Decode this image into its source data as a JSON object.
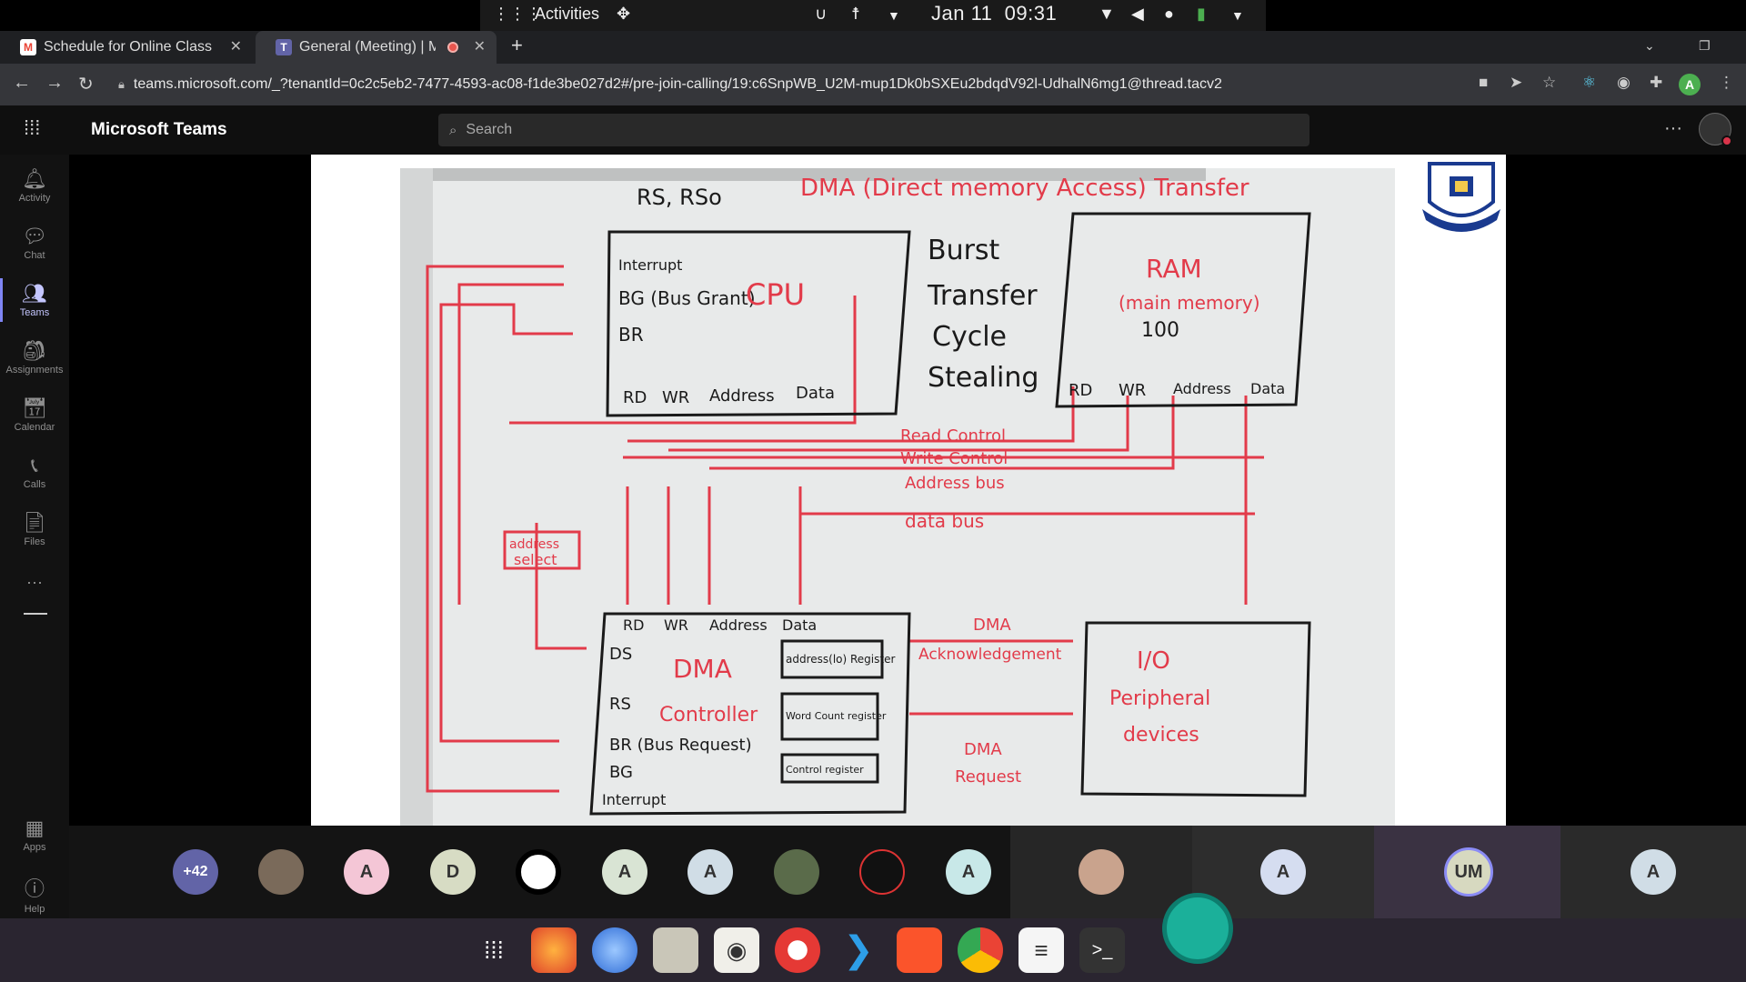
{
  "system_bar": {
    "apps_glyph": "⋮⋮⋮",
    "activities": "Activities",
    "date": "Jan 11",
    "time": "09:31"
  },
  "browser": {
    "tabs": [
      {
        "title": "Schedule for Online Class",
        "favicon": "gmail-icon",
        "active": false
      },
      {
        "title": "General (Meeting) | Mi",
        "favicon": "teams-icon",
        "active": true,
        "recording": true
      }
    ],
    "new_tab_label": "+",
    "url": "teams.microsoft.com/_?tenantId=0c2c5eb2-7477-4593-ac08-f1de3be027d2#/pre-join-calling/19:c6SnpWB_U2M-mup1Dk0bSXEu2bdqdV92l-UdhalN6mg1@thread.tacv2",
    "profile_initial": "A"
  },
  "teams": {
    "app_title": "Microsoft Teams",
    "search_placeholder": "Search",
    "rail": [
      {
        "label": "Activity",
        "icon": "bell-icon"
      },
      {
        "label": "Chat",
        "icon": "chat-icon"
      },
      {
        "label": "Teams",
        "icon": "teams-icon",
        "active": true
      },
      {
        "label": "Assignments",
        "icon": "assignments-icon"
      },
      {
        "label": "Calendar",
        "icon": "calendar-icon"
      },
      {
        "label": "Calls",
        "icon": "phone-icon"
      },
      {
        "label": "Files",
        "icon": "file-icon"
      }
    ],
    "rail_bottom": [
      {
        "label": "Apps",
        "icon": "apps-icon"
      },
      {
        "label": "Help",
        "icon": "help-icon"
      }
    ]
  },
  "whiteboard": {
    "heading": "DMA (Direct memory Access) Transfer",
    "rs_label": "RS, RSo",
    "burst": [
      "Burst",
      "Transfer",
      "Cycle",
      "Stealing"
    ],
    "cpu": {
      "title": "CPU",
      "pins": [
        "Interrupt",
        "BG (Bus Grant)",
        "BR"
      ],
      "bottom": [
        "RD",
        "WR",
        "Address",
        "Data"
      ]
    },
    "ram": {
      "title": "RAM",
      "subtitle": "(main memory)",
      "value": "100",
      "bottom": [
        "RD",
        "WR",
        "Address",
        "Data"
      ]
    },
    "buses": [
      "Read Control",
      "Write Control",
      "Address bus",
      "data bus"
    ],
    "address_select": [
      "address",
      "select"
    ],
    "dma": {
      "top": [
        "RD",
        "WR",
        "Address",
        "Data"
      ],
      "title": "DMA",
      "subtitle": "Controller",
      "pins": [
        "DS",
        "RS",
        "BR (Bus Request)",
        "BG",
        "Interrupt"
      ],
      "registers": [
        "address(lo) Register",
        "Word Count register",
        "Control register"
      ]
    },
    "io": [
      "I/O",
      "Peripheral",
      "devices"
    ],
    "ack": [
      "DMA",
      "Acknowledgement"
    ],
    "req": [
      "DMA",
      "Request"
    ]
  },
  "participants": [
    {
      "label": "+42",
      "bg": "#6264a7",
      "fg": "#ffffff",
      "kind": "overflow"
    },
    {
      "label": "",
      "kind": "photo"
    },
    {
      "label": "A",
      "bg": "#f4c6d6",
      "fg": "#333333"
    },
    {
      "label": "D",
      "bg": "#d7dcc4",
      "fg": "#333333"
    },
    {
      "label": "",
      "kind": "logo"
    },
    {
      "label": "A",
      "bg": "#d9e4d4",
      "fg": "#333333"
    },
    {
      "label": "A",
      "bg": "#d0dde6",
      "fg": "#333333"
    },
    {
      "label": "",
      "kind": "photo"
    },
    {
      "label": "",
      "kind": "logo2"
    },
    {
      "label": "A",
      "bg": "#c8e8e8",
      "fg": "#333333"
    },
    {
      "label": "",
      "kind": "photo",
      "tile": true
    },
    {
      "label": "A",
      "bg": "#d5ddf0",
      "fg": "#333333",
      "tile": true
    },
    {
      "label": "UM",
      "bg": "#d7d9c0",
      "fg": "#333333",
      "tile": true,
      "speaking": true
    },
    {
      "label": "A",
      "bg": "#d0dde6",
      "fg": "#333333",
      "tile": true
    }
  ],
  "dock": [
    {
      "name": "app-grid-icon"
    },
    {
      "name": "firefox-icon"
    },
    {
      "name": "thunderbird-icon"
    },
    {
      "name": "files-icon"
    },
    {
      "name": "rhythmbox-icon"
    },
    {
      "name": "help-lifebuoy-icon"
    },
    {
      "name": "vscode-icon"
    },
    {
      "name": "brave-icon"
    },
    {
      "name": "chrome-icon"
    },
    {
      "name": "text-editor-icon"
    },
    {
      "name": "terminal-icon"
    }
  ]
}
